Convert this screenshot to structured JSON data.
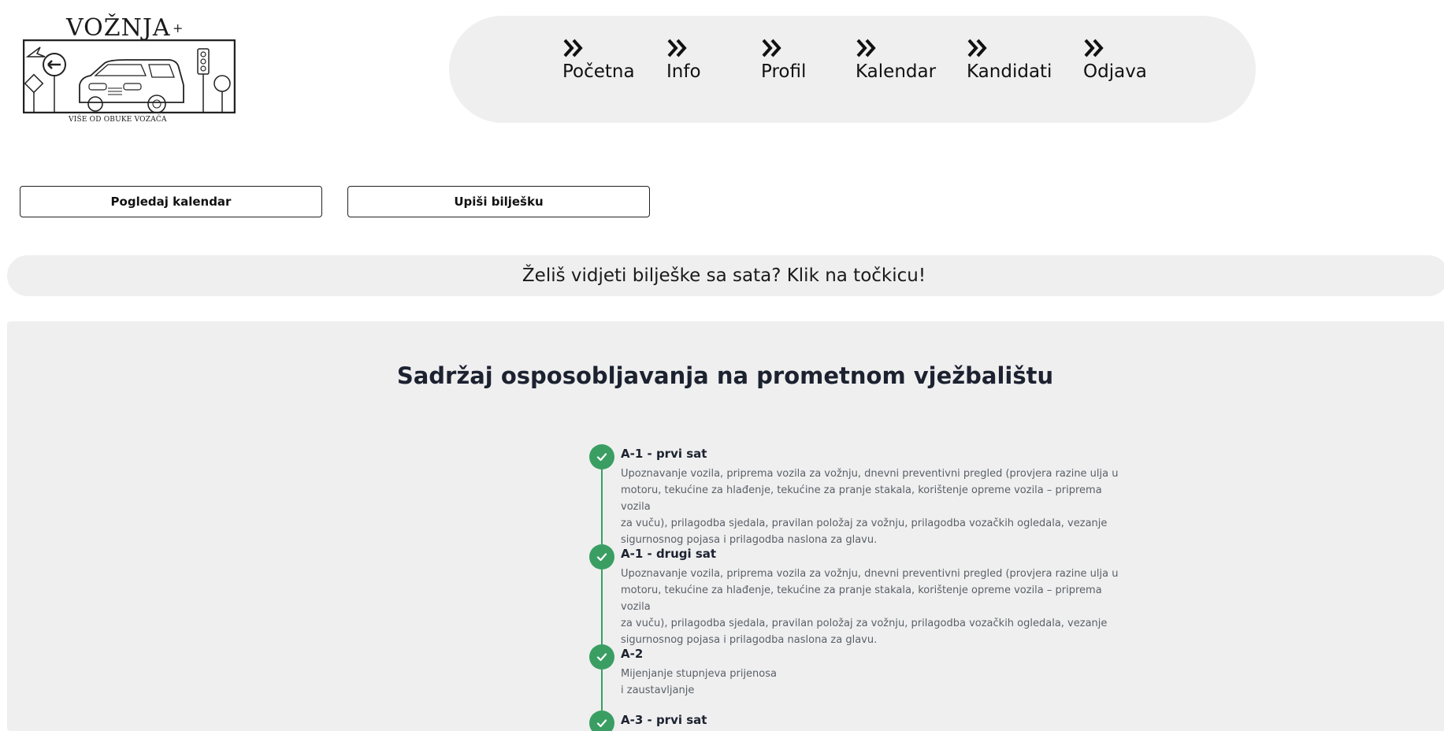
{
  "logo": {
    "title": "VOŽNJA",
    "plus": "+",
    "subtitle": "VIŠE OD OBUKE VOZAČA"
  },
  "nav": {
    "items": [
      {
        "label": "Početna",
        "icon": "double-chevron-right-icon"
      },
      {
        "label": "Info",
        "icon": "double-chevron-right-icon"
      },
      {
        "label": "Profil",
        "icon": "double-chevron-right-icon"
      },
      {
        "label": "Kalendar",
        "icon": "double-chevron-right-icon"
      },
      {
        "label": "Kandidati",
        "icon": "double-chevron-right-icon"
      },
      {
        "label": "Odjava",
        "icon": "double-chevron-right-icon"
      }
    ]
  },
  "actions": {
    "view_calendar": "Pogledaj kalendar",
    "write_note": "Upiši bilješku"
  },
  "banner": {
    "text": "Želiš vidjeti bilješke sa sata? Klik na točkicu!"
  },
  "content": {
    "title": "Sadržaj osposobljavanja na prometnom vježbalištu",
    "timeline": [
      {
        "title": "A-1 - prvi sat",
        "description": "Upoznavanje vozila, priprema vozila za vožnju, dnevni preventivni pregled (provjera razine ulja u\nmotoru, tekućine za hlađenje, tekućine za pranje stakala, korištenje opreme vozila – priprema vozila\nza vuču), prilagodba sjedala, pravilan položaj za vožnju, prilagodba vozačkih ogledala, vezanje\nsigurnosnog pojasa i prilagodba naslona za glavu.",
        "status": "done"
      },
      {
        "title": "A-1 - drugi sat",
        "description": "Upoznavanje vozila, priprema vozila za vožnju, dnevni preventivni pregled (provjera razine ulja u\nmotoru, tekućine za hlađenje, tekućine za pranje stakala, korištenje opreme vozila – priprema vozila\nza vuču), prilagodba sjedala, pravilan položaj za vožnju, prilagodba vozačkih ogledala, vezanje\nsigurnosnog pojasa i prilagodba naslona za glavu.",
        "status": "done"
      },
      {
        "title": "A-2",
        "description": "Mijenjanje stupnjeva prijenosa\ni zaustavljanje",
        "status": "done"
      },
      {
        "title": "A-3 - prvi sat",
        "description": "",
        "status": "done"
      }
    ]
  },
  "colors": {
    "panel_bg": "#efefef",
    "check_green": "#3a9e63",
    "title_dark": "#1c2230"
  }
}
